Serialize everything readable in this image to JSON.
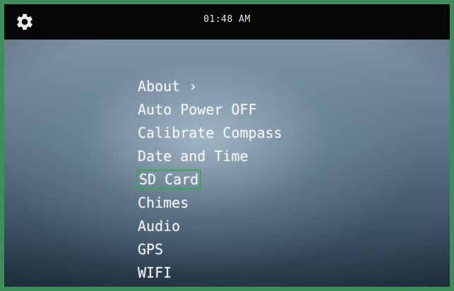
{
  "status_bar": {
    "time": "01:48 AM",
    "settings_icon": "gear-icon"
  },
  "menu": {
    "items": [
      {
        "label": "About ›"
      },
      {
        "label": "Auto Power OFF"
      },
      {
        "label": "Calibrate Compass"
      },
      {
        "label": "Date and Time"
      },
      {
        "label": "SD Card",
        "selected": true
      },
      {
        "label": "Chimes"
      },
      {
        "label": "Audio"
      },
      {
        "label": "GPS"
      },
      {
        "label": "WIFI"
      }
    ]
  },
  "colors": {
    "frame_border": "#3e8e5c",
    "selection_outline": "#3aa655",
    "status_bar_bg": "#050606",
    "text": "#f4f6f7"
  }
}
